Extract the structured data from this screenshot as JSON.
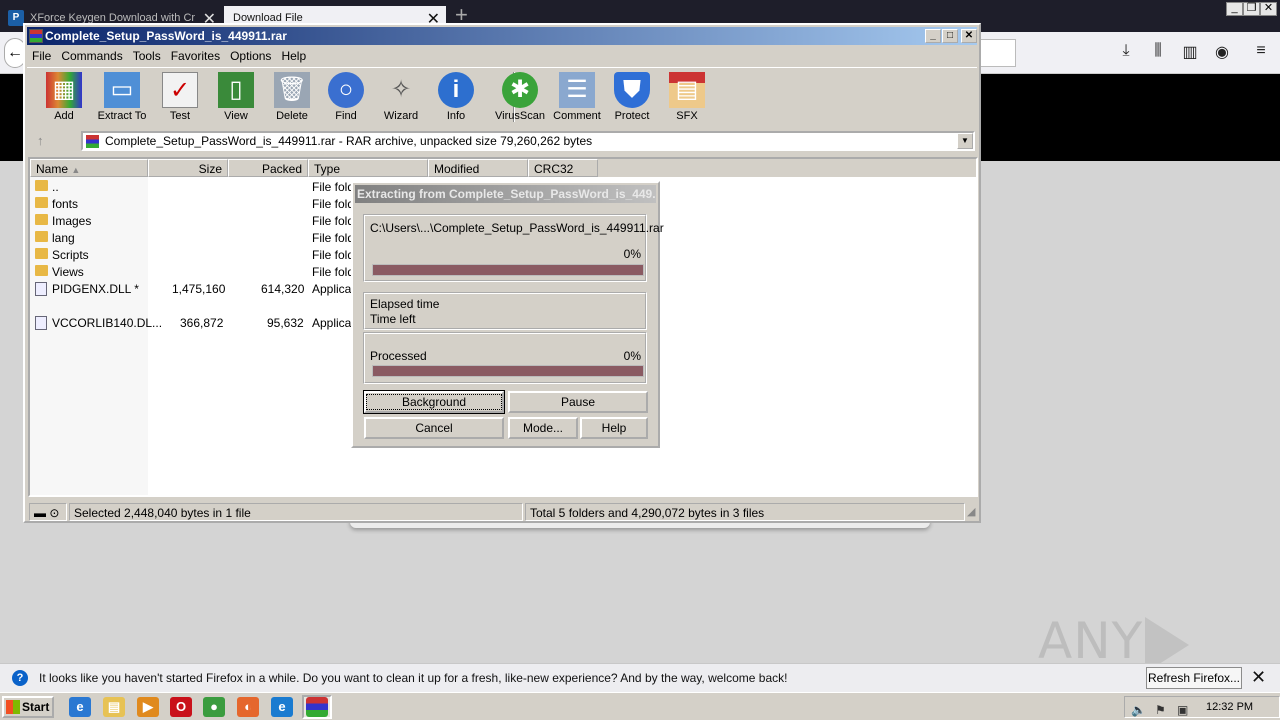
{
  "browser": {
    "tabs": [
      {
        "label": "XForce Keygen Download with Cr",
        "active": false
      },
      {
        "label": "Download File",
        "active": true
      }
    ],
    "notification": {
      "text": "It looks like you haven't started Firefox in a while. Do you want to clean it up for a fresh, like-new experience? And by the way, welcome back!",
      "button": "Refresh Firefox..."
    },
    "watermark": "ANY RUN"
  },
  "winrar": {
    "title": "Complete_Setup_PassWord_is_449911.rar",
    "menu": [
      "File",
      "Commands",
      "Tools",
      "Favorites",
      "Options",
      "Help"
    ],
    "toolbar": [
      {
        "label": "Add",
        "icon": "add-icon"
      },
      {
        "label": "Extract To",
        "icon": "extract-icon"
      },
      {
        "label": "Test",
        "icon": "test-icon"
      },
      {
        "label": "View",
        "icon": "view-icon"
      },
      {
        "label": "Delete",
        "icon": "delete-icon"
      },
      {
        "label": "Find",
        "icon": "find-icon"
      },
      {
        "label": "Wizard",
        "icon": "wizard-icon"
      },
      {
        "label": "Info",
        "icon": "info-icon"
      },
      {
        "label": "VirusScan",
        "icon": "virusscan-icon"
      },
      {
        "label": "Comment",
        "icon": "comment-icon"
      },
      {
        "label": "Protect",
        "icon": "protect-icon"
      },
      {
        "label": "SFX",
        "icon": "sfx-icon"
      }
    ],
    "address": "Complete_Setup_PassWord_is_449911.rar - RAR archive, unpacked size 79,260,262 bytes",
    "columns": [
      "Name",
      "Size",
      "Packed",
      "Type",
      "Modified",
      "CRC32"
    ],
    "files": [
      {
        "name": "..",
        "size": "",
        "packed": "",
        "type": "File fold",
        "kind": "folder"
      },
      {
        "name": "fonts",
        "size": "",
        "packed": "",
        "type": "File fold",
        "kind": "folder"
      },
      {
        "name": "Images",
        "size": "",
        "packed": "",
        "type": "File fold",
        "kind": "folder"
      },
      {
        "name": "lang",
        "size": "",
        "packed": "",
        "type": "File fold",
        "kind": "folder"
      },
      {
        "name": "Scripts",
        "size": "",
        "packed": "",
        "type": "File fold",
        "kind": "folder"
      },
      {
        "name": "Views",
        "size": "",
        "packed": "",
        "type": "File fold",
        "kind": "folder"
      },
      {
        "name": "PIDGENX.DLL *",
        "size": "1,475,160",
        "packed": "614,320",
        "type": "Applicat",
        "kind": "file"
      },
      {
        "name": "VCCORLIB140.DL...",
        "size": "366,872",
        "packed": "95,632",
        "type": "Applicat",
        "kind": "file"
      }
    ],
    "status_left": "Selected 2,448,040 bytes in 1 file",
    "status_right": "Total 5 folders and 4,290,072 bytes in 3 files"
  },
  "dialog": {
    "title": "Extracting from Complete_Setup_PassWord_is_449...",
    "path": "C:\\Users\\...\\Complete_Setup_PassWord_is_449911.rar",
    "file_percent": "0%",
    "elapsed_label": "Elapsed time",
    "time_left_label": "Time left",
    "processed_label": "Processed",
    "processed_percent": "0%",
    "buttons": {
      "background": "Background",
      "pause": "Pause",
      "cancel": "Cancel",
      "mode": "Mode...",
      "help": "Help"
    }
  },
  "taskbar": {
    "start": "Start",
    "clock": "12:32 PM"
  }
}
